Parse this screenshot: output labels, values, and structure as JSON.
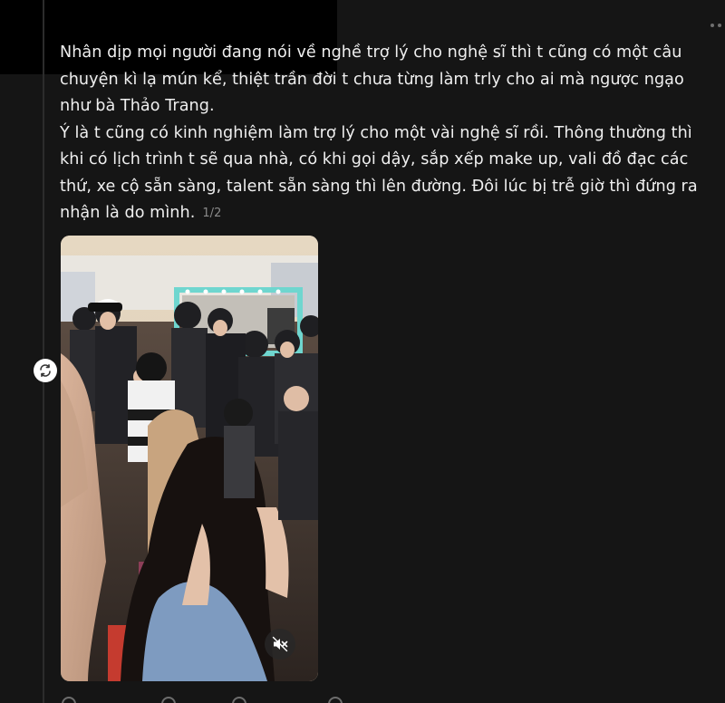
{
  "post": {
    "lines": [
      "Nhân dịp mọi người đang nói về nghề trợ lý cho nghệ sĩ thì t cũng có một câu",
      "chuyện kì lạ mún kể, thiệt trần đời t chưa từng làm trly cho ai mà ngược ngạo",
      "như bà Thảo Trang.",
      "Ý là t cũng có kinh nghiệm làm trợ lý cho một vài nghệ sĩ rồi. Thông thường thì",
      "khi có lịch trình t sẽ qua nhà, có khi gọi dậy, sắp xếp make up, vali đồ đạc các",
      "thứ, xe cộ sẵn sàng, talent sẵn sàng thì lên đường. Đôi lúc bị trễ giờ thì đứng ra",
      "nhận là do mình."
    ],
    "page_counter": "1/2"
  },
  "icons": {
    "more": "more-horizontal-icon",
    "repost": "repost-icon",
    "mute": "speaker-muted-icon"
  },
  "colors": {
    "background": "#151515",
    "text": "#efefef",
    "muted_text": "#8a8a8a",
    "redaction": "#000000"
  }
}
